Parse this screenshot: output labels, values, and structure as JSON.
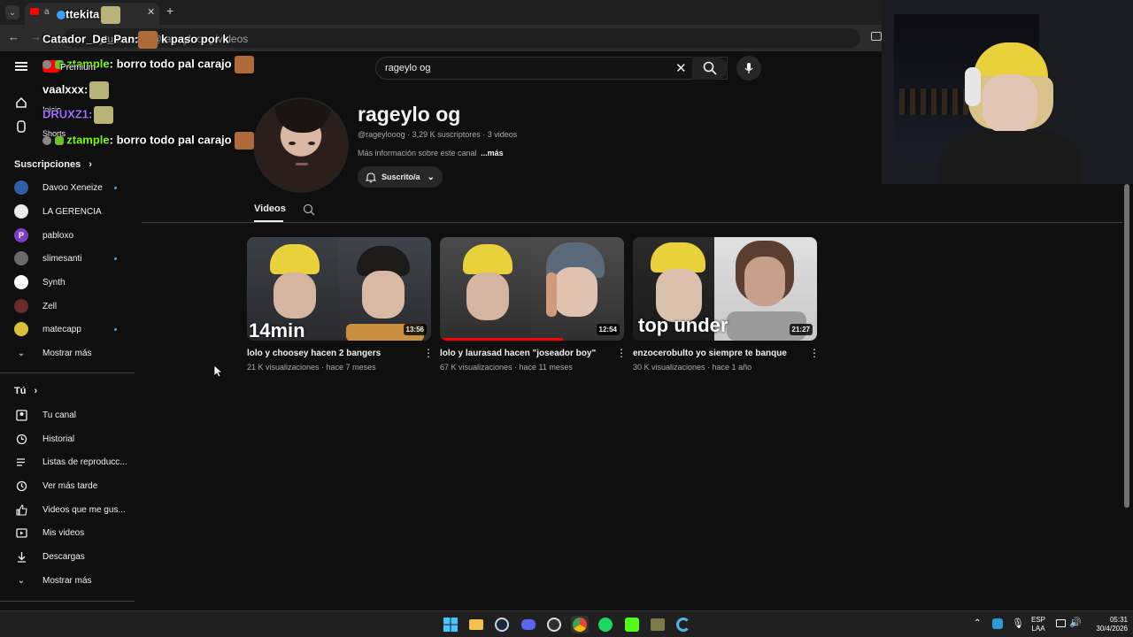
{
  "browser": {
    "tab_title": "ttekita",
    "tab_prefix": "a",
    "omnibox_text": "ytube.com/@rageylooog/videos"
  },
  "youtube": {
    "premium_label": "Premium",
    "search_query": "rageylo og",
    "nav": [
      {
        "label": "Inicio",
        "icon": "home-icon"
      },
      {
        "label": "Shorts",
        "icon": "shorts-icon"
      }
    ],
    "subscriptions_heading": "Suscripciones",
    "subscriptions": [
      {
        "label": "Davoo Xeneize",
        "dot": true,
        "color": "#2c5fa8"
      },
      {
        "label": "LA GERENCIA",
        "dot": false,
        "color": "#eaeaea"
      },
      {
        "label": "pabloxo",
        "dot": false,
        "color": "#7b3fc4",
        "letter": "P"
      },
      {
        "label": "slimesanti",
        "dot": true,
        "color": "#6a6a6a"
      },
      {
        "label": "Synth",
        "dot": false,
        "color": "#ffffff"
      },
      {
        "label": "Zell",
        "dot": false,
        "color": "#6b2b2b"
      },
      {
        "label": "matecapp",
        "dot": true,
        "color": "#d9c23b"
      }
    ],
    "show_more": "Mostrar más",
    "you_heading": "Tú",
    "you_items": [
      {
        "label": "Tu canal",
        "icon": "channel-icon"
      },
      {
        "label": "Historial",
        "icon": "history-icon"
      },
      {
        "label": "Listas de reproducc...",
        "icon": "playlist-icon"
      },
      {
        "label": "Ver más tarde",
        "icon": "clock-icon"
      },
      {
        "label": "Videos que me gus...",
        "icon": "thumbs-up-icon"
      },
      {
        "label": "Mis videos",
        "icon": "my-videos-icon"
      },
      {
        "label": "Descargas",
        "icon": "download-icon"
      }
    ],
    "show_more_2": "Mostrar más",
    "channel": {
      "name": "rageylo og",
      "meta": "@rageylooog · 3,29 K suscriptores · 3 videos",
      "about": "Más información sobre este canal",
      "about_more": "...más",
      "subscribed_label": "Suscrito/a",
      "tab_videos": "Videos"
    },
    "videos": [
      {
        "title": "lolo y choosey hacen 2 bangers",
        "meta": "21 K visualizaciones · hace 7 meses",
        "duration": "13:56",
        "overlay": "14min",
        "progress": 0
      },
      {
        "title": "lolo y laurasad hacen \"joseador boy\"",
        "meta": "67 K visualizaciones · hace 11 meses",
        "duration": "12:54",
        "overlay": "",
        "progress": 0.67
      },
      {
        "title": "enzocerobulto yo siempre te banque",
        "meta": "30 K visualizaciones · hace 1 año",
        "duration": "21:27",
        "overlay": "top under",
        "progress": 0
      }
    ]
  },
  "chat": [
    {
      "user": "Catador_De_Pan:",
      "msg": " k paso por k",
      "color": "#ffffff"
    },
    {
      "user": "ztample",
      "msg": ": borro todo pal carajo",
      "color": "#7CFC00"
    },
    {
      "user": "vaalxxx:",
      "msg": "",
      "color": "#ffffff"
    },
    {
      "user": "DRUXZ1:",
      "msg": "",
      "color": "#a36bff"
    },
    {
      "user": "ztample",
      "msg": ": borro todo pal carajo",
      "color": "#7CFC00"
    }
  ],
  "taskbar": {
    "lang_top": "ESP",
    "lang_bottom": "LAA",
    "time": "05:31",
    "date": "30/4/2026"
  }
}
